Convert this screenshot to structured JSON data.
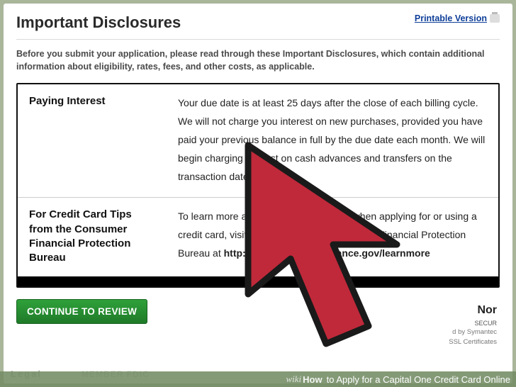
{
  "header": {
    "title": "Important Disclosures",
    "printable_label": "Printable Version"
  },
  "intro": "Before you submit your application, please read through these Important Disclosures, which contain additional information about eligibility, rates, fees, and other costs, as applicable.",
  "disclosures": {
    "rows": [
      {
        "label": "Paying Interest",
        "text": "Your due date is at least 25 days after the close of each billing cycle. We will not charge you interest on new purchases, provided you have paid your previous balance in full by the due date each month. We will begin charging interest on cash advances and transfers on the transaction date."
      },
      {
        "label": "For Credit Card Tips from the Consumer Financial Protection Bureau",
        "text_prefix": "To learn more about factors to consider when applying for or using a credit card, visit the website of the Consumer Financial Protection Bureau at ",
        "text_bold": "http://www.consumerfinance.gov/learnmore"
      }
    ]
  },
  "buttons": {
    "continue": "CONTINUE TO REVIEW"
  },
  "badge": {
    "brand_fragment": "Nor",
    "secured": "SECUR",
    "powered": "d by Symantec",
    "cert": "SSL Certificates"
  },
  "footer": {
    "legal": "Legal",
    "member": "MEMBER FDIC"
  },
  "caption": {
    "wiki": "wiki",
    "how": "How",
    "text": " to Apply for a Capital One Credit Card Online"
  }
}
